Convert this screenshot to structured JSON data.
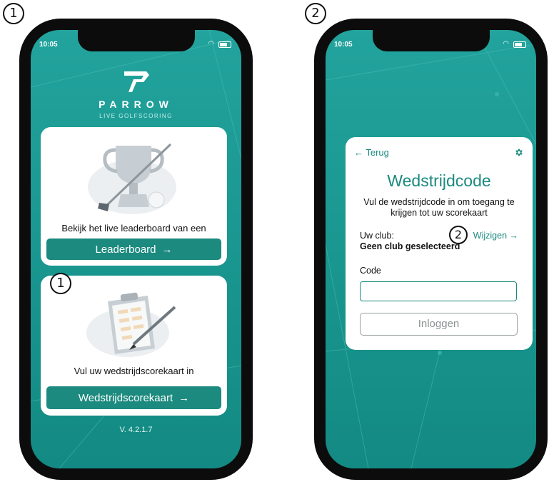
{
  "markers": {
    "one": "1",
    "two": "2"
  },
  "status_bar": {
    "time": "10:05"
  },
  "phone1": {
    "brand": "PARROW",
    "tagline": "LIVE GOLFSCORING",
    "leaderboard_card": {
      "text": "Bekijk het live leaderboard van een",
      "button_label": "Leaderboard",
      "button_icon": "→"
    },
    "scorecard_card": {
      "text": "Vul uw wedstrijdscorekaart in",
      "button_label": "Wedstrijdscorekaart",
      "button_icon": "→"
    },
    "version": "V. 4.2.1.7"
  },
  "phone2": {
    "back_label": "← Terug",
    "title": "Wedstrijdcode",
    "description": "Vul de wedstrijdcode in om toegang te krijgen tot uw scorekaart",
    "club_label": "Uw club:",
    "club_value": "Geen club geselecteerd",
    "change_label": "Wijzigen →",
    "code_label": "Code",
    "code_value": "",
    "login_label": "Inloggen"
  },
  "colors": {
    "teal": "#1c8a7f",
    "screen_bg": "#1a9891",
    "accent_text": "#1c8a7f"
  }
}
